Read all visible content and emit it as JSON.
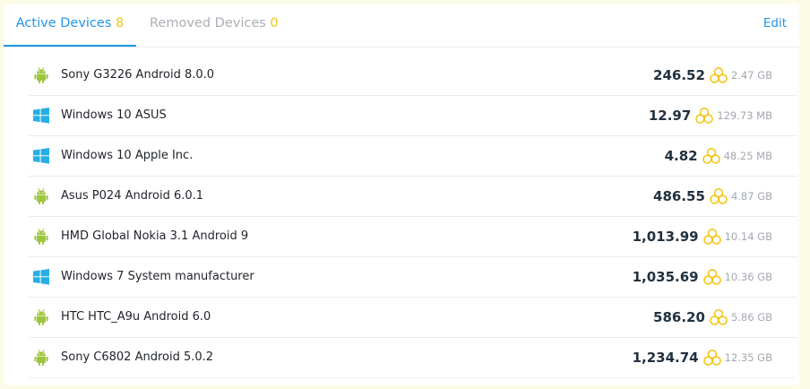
{
  "tabs": {
    "active": {
      "label": "Active Devices",
      "count": "8"
    },
    "removed": {
      "label": "Removed Devices",
      "count": "0"
    },
    "edit_label": "Edit"
  },
  "colors": {
    "accent": "#2196e6",
    "count": "#f2c617",
    "android": "#9ec53e",
    "windows": "#27aee6",
    "coin": "#f2c617"
  },
  "devices": [
    {
      "os_icon": "android-icon",
      "name": "Sony G3226 Android 8.0.0",
      "amount": "246.52",
      "size": "2.47 GB"
    },
    {
      "os_icon": "windows-icon",
      "name": "Windows 10 ASUS",
      "amount": "12.97",
      "size": "129.73 MB"
    },
    {
      "os_icon": "windows-icon",
      "name": "Windows 10 Apple Inc.",
      "amount": "4.82",
      "size": "48.25 MB"
    },
    {
      "os_icon": "android-icon",
      "name": "Asus P024 Android 6.0.1",
      "amount": "486.55",
      "size": "4.87 GB"
    },
    {
      "os_icon": "android-icon",
      "name": "HMD Global Nokia 3.1 Android 9",
      "amount": "1,013.99",
      "size": "10.14 GB"
    },
    {
      "os_icon": "windows-icon",
      "name": "Windows 7 System manufacturer",
      "amount": "1,035.69",
      "size": "10.36 GB"
    },
    {
      "os_icon": "android-icon",
      "name": "HTC HTC_A9u Android 6.0",
      "amount": "586.20",
      "size": "5.86 GB"
    },
    {
      "os_icon": "android-icon",
      "name": "Sony C6802 Android 5.0.2",
      "amount": "1,234.74",
      "size": "12.35 GB"
    }
  ]
}
